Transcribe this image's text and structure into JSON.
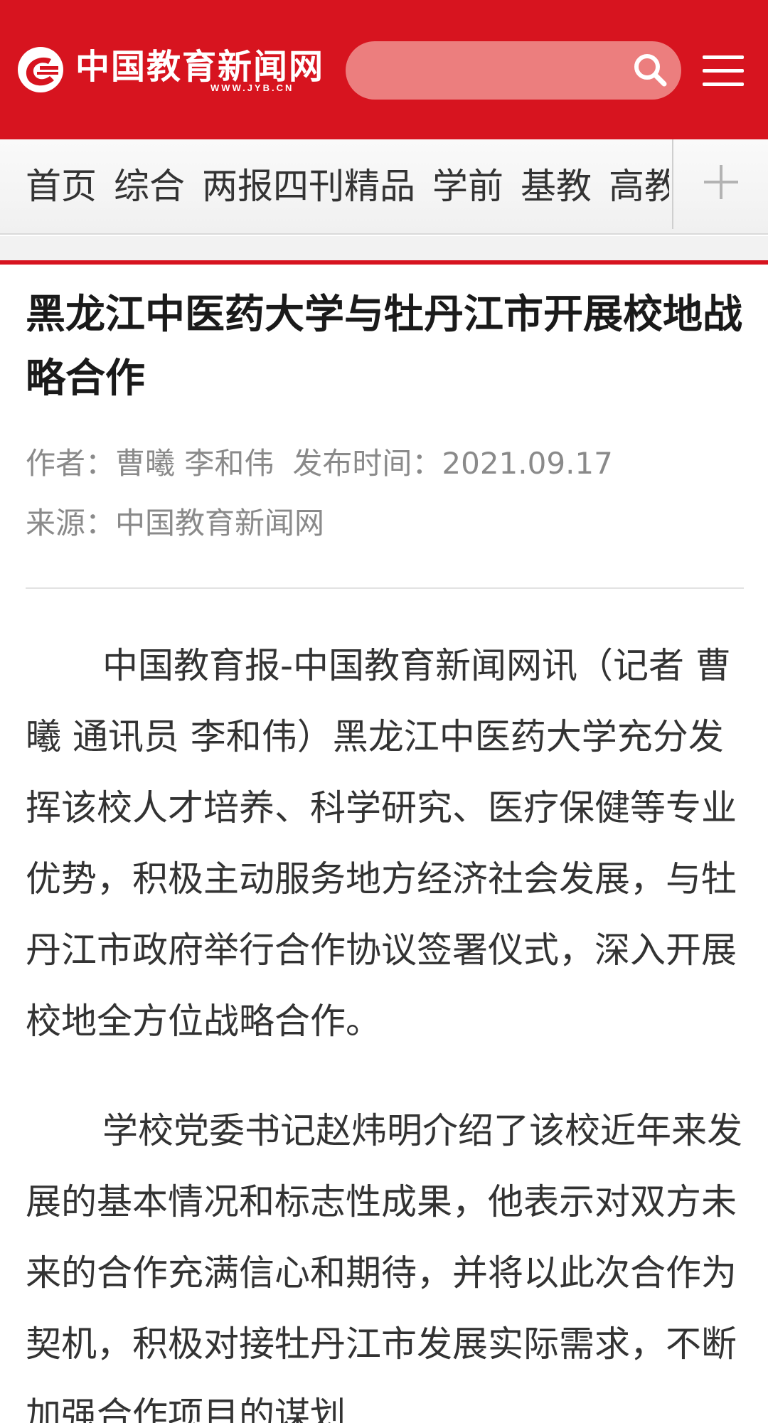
{
  "header": {
    "logo_cn": "中国教育新闻网",
    "logo_url": "WWW.JYB.CN",
    "search_placeholder": "",
    "brand_color": "#d7141f"
  },
  "nav": {
    "items": [
      "首页",
      "综合",
      "两报四刊精品",
      "学前",
      "基教",
      "高教"
    ],
    "more_icon": "plus-icon"
  },
  "article": {
    "title": "黑龙江中医药大学与牡丹江市开展校地战略合作",
    "author_label": "作者：",
    "author": "曹曦 李和伟",
    "time_label": "发布时间：",
    "time": "2021.09.17",
    "source_label": "来源：",
    "source": "中国教育新闻网",
    "paragraphs": [
      "中国教育报-中国教育新闻网讯（记者 曹曦 通讯员 李和伟）黑龙江中医药大学充分发挥该校人才培养、科学研究、医疗保健等专业优势，积极主动服务地方经济社会发展，与牡丹江市政府举行合作协议签署仪式，深入开展校地全方位战略合作。",
      "学校党委书记赵炜明介绍了该校近年来发展的基本情况和标志性成果，他表示对双方未来的合作充满信心和期待，并将以此次合作为契机，积极对接牡丹江市发展实际需求，不断加强合作项目的谋划"
    ]
  }
}
